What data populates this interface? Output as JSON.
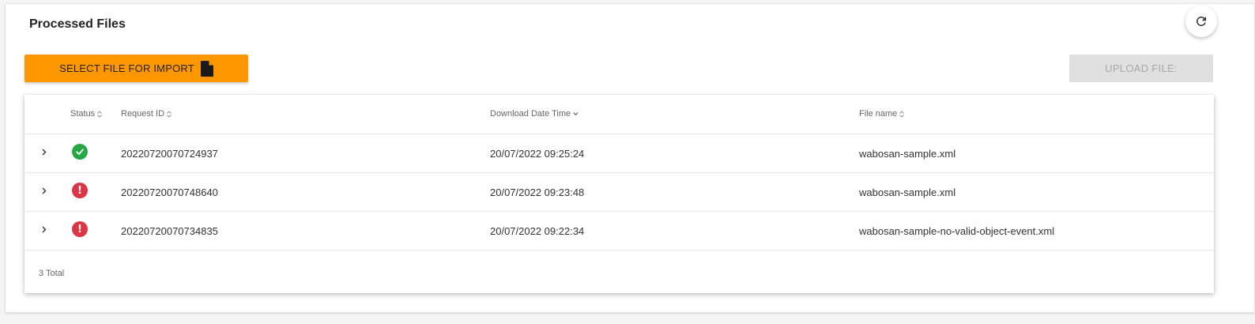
{
  "title": "Processed Files",
  "toolbar": {
    "select_label": "SELECT FILE FOR IMPORT",
    "upload_label": "UPLOAD FILE:",
    "refresh_icon": "refresh-icon",
    "file_icon": "file-icon"
  },
  "table": {
    "headers": {
      "status": "Status",
      "request_id": "Request ID",
      "download_date": "Download Date Time",
      "file_name": "File name"
    },
    "rows": [
      {
        "status": "success",
        "request_id": "20220720070724937",
        "date": "20/07/2022 09:25:24",
        "file": "wabosan-sample.xml"
      },
      {
        "status": "error",
        "request_id": "20220720070748640",
        "date": "20/07/2022 09:23:48",
        "file": "wabosan-sample.xml"
      },
      {
        "status": "error",
        "request_id": "20220720070734835",
        "date": "20/07/2022 09:22:34",
        "file": "wabosan-sample-no-valid-object-event.xml"
      }
    ],
    "total": "3 Total"
  },
  "colors": {
    "accent": "#ff9800",
    "success": "#28a745",
    "error": "#dc3545",
    "disabled": "#e0e0e0"
  }
}
